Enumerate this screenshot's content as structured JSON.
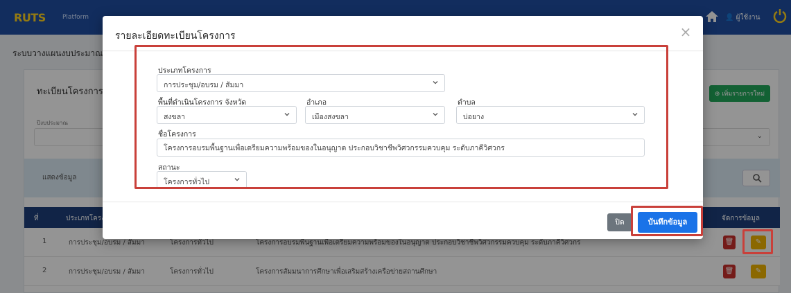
{
  "app": {
    "brand_main": "RUTS",
    "brand_sub": "Platform",
    "user_label": "ผู้ใช้งาน",
    "page_heading": "ระบบวางแผนงบประมาณ"
  },
  "card": {
    "title": "ทะเบียนโครงการ",
    "add_button": "เพิ่มรายการใหม่",
    "filter_label": "ปีงบประมาณ",
    "search_label": "แสดงข้อมูล"
  },
  "table": {
    "headers": {
      "no": "ที่",
      "type": "ประเภทโครงการ",
      "manage": "จัดการข้อมูล"
    },
    "rows": [
      {
        "no": "1",
        "type": "การประชุม/อบรม / สัมมา",
        "status": "โครงการทั่วไป",
        "name": "โครงการอบรมพื้นฐานเพื่อเตรียมความพร้อมของในอนุญาต ประกอบวิชาชีพวิศวกรรมควบคุม ระดับภาคีวิศวกร"
      },
      {
        "no": "2",
        "type": "การประชุม/อบรม / สัมมา",
        "status": "โครงการทั่วไป",
        "name": "โครงการสัมมนาการศึกษาเพื่อเสริมสร้างเครือข่ายสถานศึกษา"
      }
    ]
  },
  "modal": {
    "title": "รายละเอียดทะเบียนโครงการ",
    "project_type": {
      "label": "ประเภทโครงการ",
      "value": "การประชุม/อบรม / สัมมา"
    },
    "province": {
      "label": "พื้นที่ดำเนินโครงการ จังหวัด",
      "value": "สงขลา"
    },
    "district": {
      "label": "อำเภอ",
      "value": "เมืองสงขลา"
    },
    "subdistrict": {
      "label": "ตำบล",
      "value": "บ่อยาง"
    },
    "project_name": {
      "label": "ชื่อโครงการ",
      "value": "โครงการอบรมพื้นฐานเพื่อเตรียมความพร้อมของในอนุญาต ประกอบวิชาชีพวิศวกรรมควบคุม ระดับภาคีวิศวกร"
    },
    "status": {
      "label": "สถานะ",
      "value": "โครงการทั่วไป"
    },
    "close_button": "ปิด",
    "save_button": "บันทึกข้อมูล"
  },
  "colors": {
    "topbar": "#1f4fa3",
    "highlight": "#c9403a",
    "save": "#1a73e8"
  }
}
